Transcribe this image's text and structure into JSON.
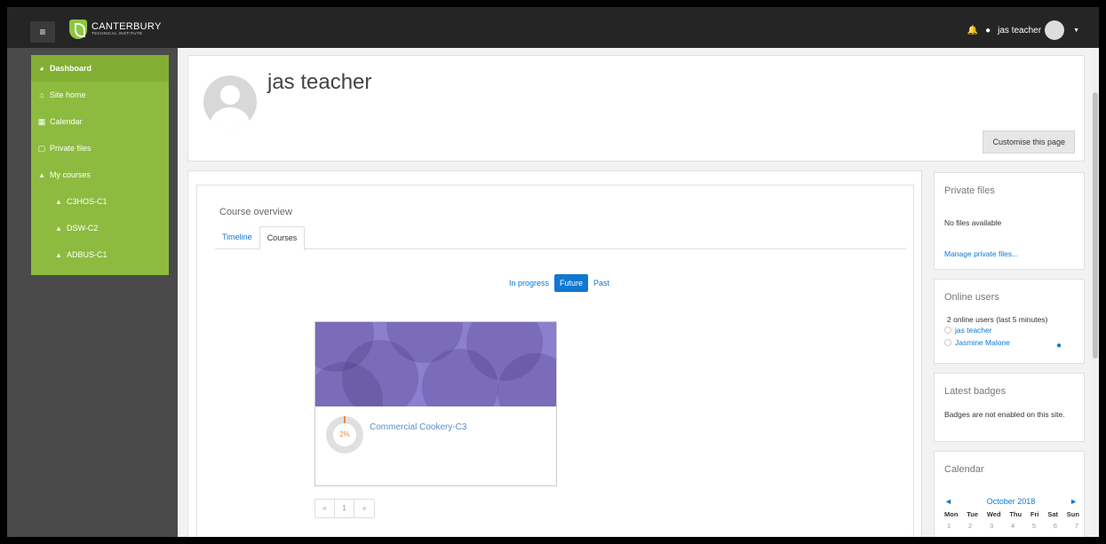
{
  "brand": {
    "name": "CANTERBURY",
    "sub": "TECHNICAL INSTITUTE",
    "color": "#8dc63f"
  },
  "navbar": {
    "user_name": "jas teacher",
    "icons": [
      "bell-icon",
      "chat-icon",
      "chevron-down-icon"
    ]
  },
  "sidebar": {
    "items": [
      {
        "label": "Dashboard",
        "icon": "dashboard-icon",
        "active": true
      },
      {
        "label": "Site home",
        "icon": "home-icon"
      },
      {
        "label": "Calendar",
        "icon": "calendar-icon"
      },
      {
        "label": "Private files",
        "icon": "file-icon"
      },
      {
        "label": "My courses",
        "icon": "graduation-cap-icon"
      },
      {
        "label": "C3HOS-C1",
        "icon": "graduation-cap-icon"
      },
      {
        "label": "DSW-C2",
        "icon": "graduation-cap-icon"
      },
      {
        "label": "ADBUS-C1",
        "icon": "graduation-cap-icon"
      }
    ]
  },
  "header": {
    "user_name": "jas teacher",
    "customise_label": "Customise this page"
  },
  "course_overview": {
    "title": "Course overview",
    "tabs": [
      {
        "label": "Timeline"
      },
      {
        "label": "Courses",
        "active": true
      }
    ],
    "filters": [
      {
        "label": "In progress"
      },
      {
        "label": "Future",
        "active": true
      },
      {
        "label": "Past"
      }
    ],
    "course": {
      "name": "Commercial Cookery-C3",
      "progress": "2%"
    },
    "pager": [
      "«",
      "1",
      "»"
    ]
  },
  "private_files": {
    "title": "Private files",
    "empty_text": "No files available",
    "manage_link": "Manage private files..."
  },
  "online_users": {
    "title": "Online users",
    "summary": "2 online users (last 5 minutes)",
    "users": [
      "jas teacher",
      "Jasmine Malone"
    ]
  },
  "latest_badges": {
    "title": "Latest badges",
    "text": "Badges are not enabled on this site."
  },
  "calendar": {
    "title": "Calendar",
    "month": "October 2018",
    "prev": "◄",
    "next": "►",
    "weekdays": [
      "Mon",
      "Tue",
      "Wed",
      "Thu",
      "Fri",
      "Sat",
      "Sun"
    ],
    "first_week": [
      "1",
      "2",
      "3",
      "4",
      "5",
      "6",
      "7"
    ]
  },
  "colors": {
    "sidebar_menu": "#8dbb3f",
    "link": "#1177d1",
    "navbar": "#252525",
    "progress": "#f0883e"
  }
}
